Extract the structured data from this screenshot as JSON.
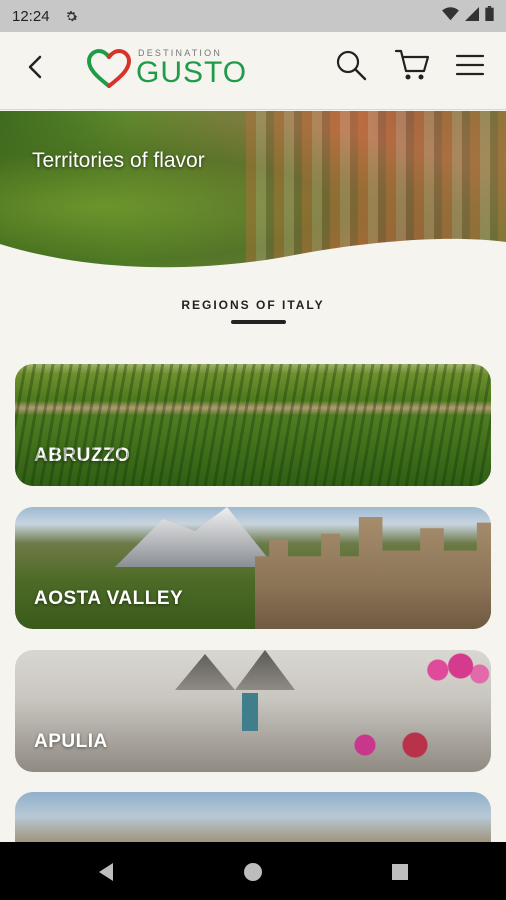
{
  "status_bar": {
    "time": "12:24",
    "icons": [
      "settings-gear-icon",
      "wifi-icon",
      "cellular-signal-icon",
      "battery-icon"
    ]
  },
  "header": {
    "back_icon": "chevron-left-icon",
    "logo": {
      "small_text": "DESTINATION",
      "big_text": "GUSTO",
      "colors": {
        "green": "#1f9b4a",
        "red": "#d8322c"
      }
    },
    "actions": [
      "search-icon",
      "cart-icon",
      "menu-icon"
    ]
  },
  "hero": {
    "title": "Territories of flavor"
  },
  "section": {
    "heading": "REGIONS OF ITALY"
  },
  "regions": [
    {
      "name": "ABRUZZO"
    },
    {
      "name": "AOSTA VALLEY"
    },
    {
      "name": "APULIA"
    },
    {
      "name": ""
    }
  ],
  "nav_bar": {
    "buttons": [
      "back-triangle-icon",
      "home-circle-icon",
      "recents-square-icon"
    ]
  }
}
